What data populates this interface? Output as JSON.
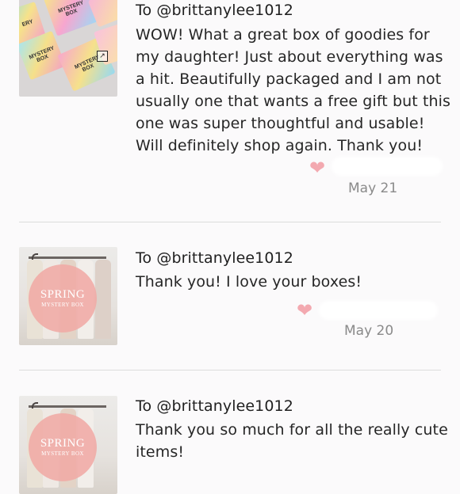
{
  "reviews": [
    {
      "to": "To @brittanylee1012",
      "message": "WOW! What a great box of goodies for my daughter! Just about everything was a hit. Beautifully packaged and I am not usually one that wants a free gift but this one was super thoughtful and usable! Will definitely shop again. Thank you!",
      "date": "May 21",
      "box_labels": [
        "ERY",
        "MYSTERY BOX",
        "MYSTERY BOX",
        "MYSTERY BOX"
      ]
    },
    {
      "to": "To @brittanylee1012",
      "message": "Thank you! I love your boxes!",
      "date": "May 20",
      "badge_title": "SPRING",
      "badge_sub": "MYSTERY BOX"
    },
    {
      "to": "To @brittanylee1012",
      "message": "Thank you so much for all the really cute items!",
      "badge_title": "SPRING",
      "badge_sub": "MYSTERY BOX"
    }
  ],
  "icons": {
    "heart": "heart-icon",
    "expand": "expand-link-icon"
  },
  "colors": {
    "heart": "#f3a9b0",
    "background": "#fbfafb",
    "date": "#8a8a8a"
  }
}
